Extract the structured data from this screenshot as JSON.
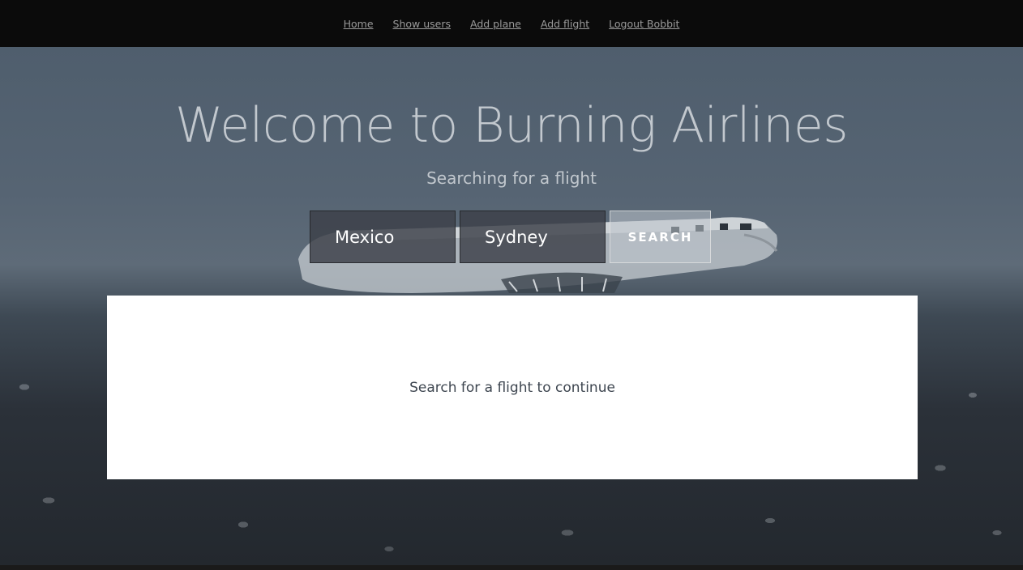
{
  "nav": {
    "items": [
      {
        "label": "Home"
      },
      {
        "label": "Show users"
      },
      {
        "label": "Add plane"
      },
      {
        "label": "Add flight"
      },
      {
        "label": "Logout Bobbit"
      }
    ]
  },
  "hero": {
    "title": "Welcome to Burning Airlines",
    "subtitle": "Searching for a flight"
  },
  "search": {
    "origin_value": "Mexico",
    "destination_value": "Sydney",
    "button_label": "SEARCH"
  },
  "results": {
    "message": "Search for a flight to continue"
  }
}
